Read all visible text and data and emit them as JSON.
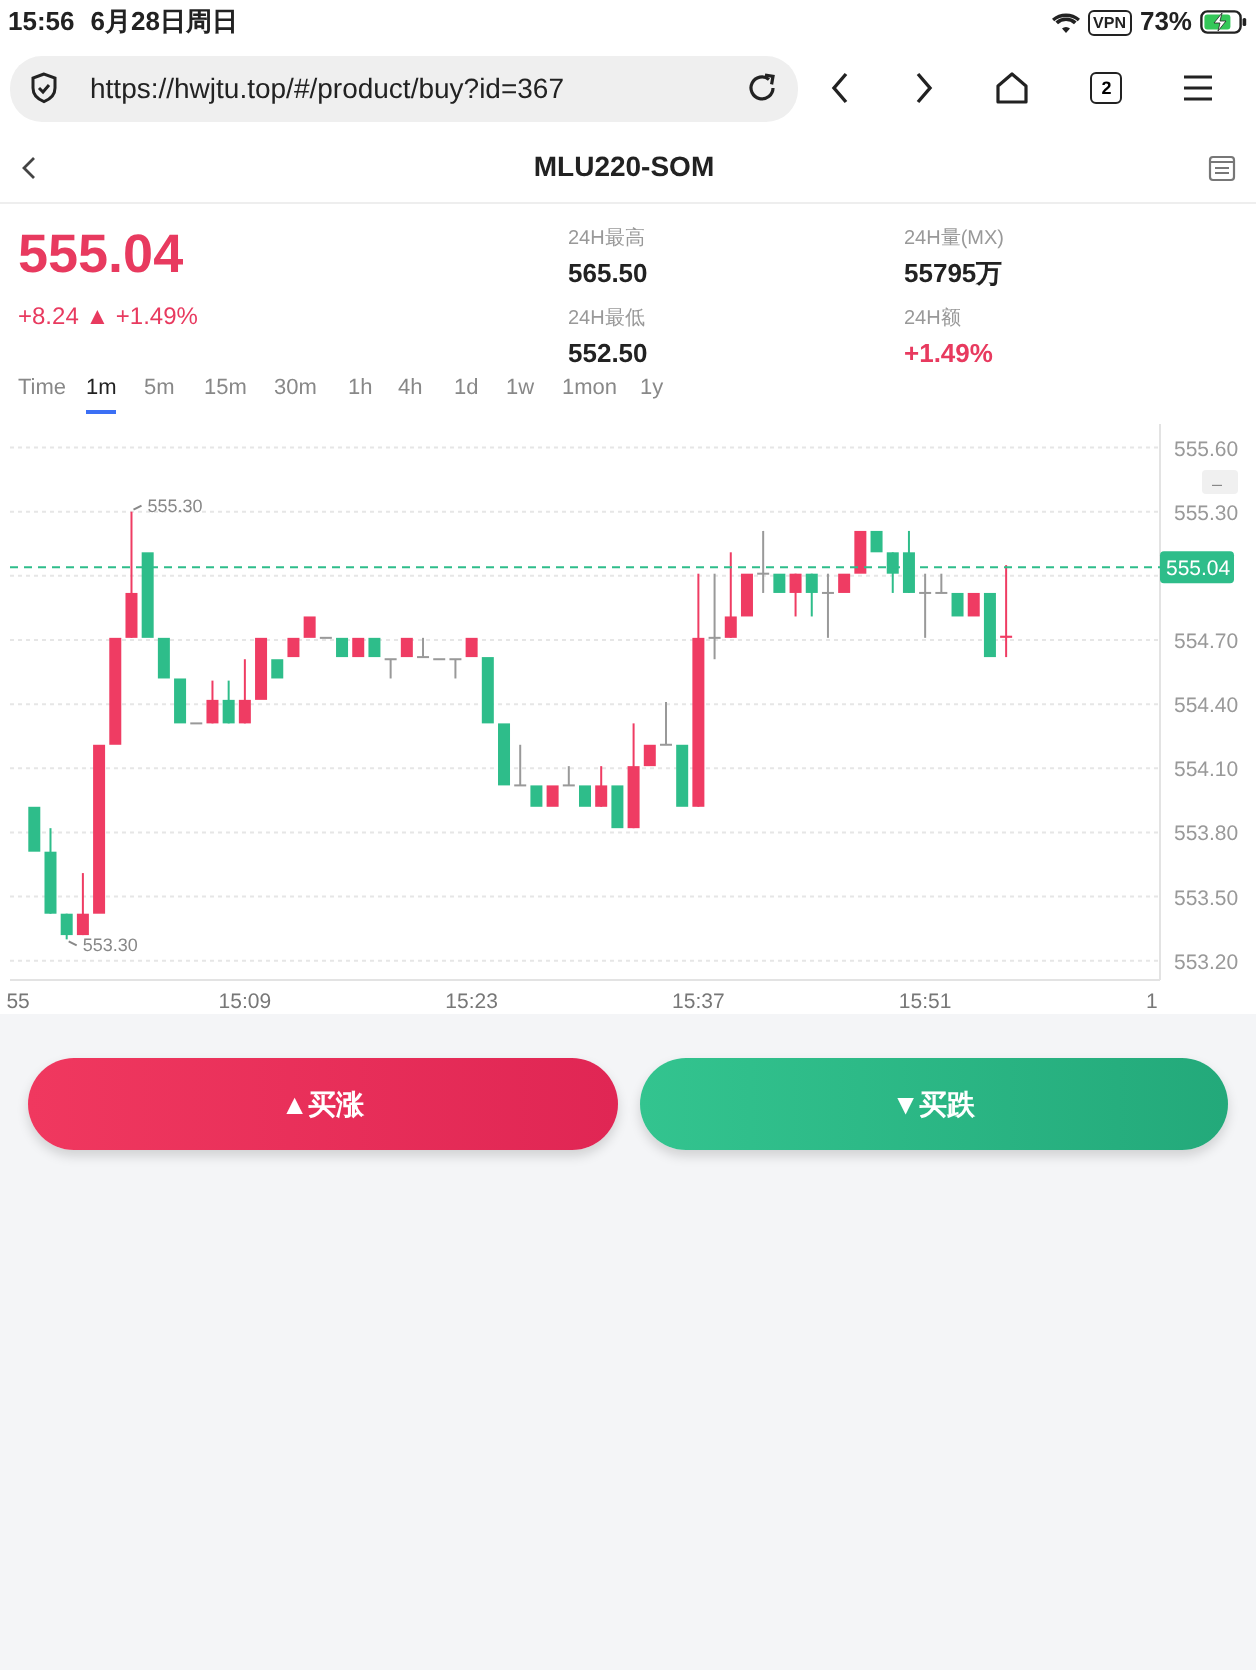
{
  "status_bar": {
    "time": "15:56",
    "date": "6月28日周日",
    "vpn": "VPN",
    "battery": "73%"
  },
  "browser": {
    "url": "https://hwjtu.top/#/product/buy?id=367",
    "tab_count": "2"
  },
  "header": {
    "title": "MLU220-SOM"
  },
  "quote": {
    "price": "555.04",
    "change": "+8.24 ▲ +1.49%"
  },
  "stats": [
    {
      "label": "24H最高",
      "value": "565.50",
      "kind": "plain"
    },
    {
      "label": "24H量(MX)",
      "value": "55795万",
      "kind": "plain"
    },
    {
      "label": "24H最低",
      "value": "552.50",
      "kind": "plain"
    },
    {
      "label": "24H额",
      "value": "+1.49%",
      "kind": "up"
    }
  ],
  "intervals": [
    {
      "label": "Time",
      "selected": false
    },
    {
      "label": "1m",
      "selected": true
    },
    {
      "label": "5m",
      "selected": false
    },
    {
      "label": "15m",
      "selected": false
    },
    {
      "label": "30m",
      "selected": false
    },
    {
      "label": "1h",
      "selected": false
    },
    {
      "label": "4h",
      "selected": false
    },
    {
      "label": "1d",
      "selected": false
    },
    {
      "label": "1w",
      "selected": false
    },
    {
      "label": "1mon",
      "selected": false
    },
    {
      "label": "1y",
      "selected": false
    }
  ],
  "chart": {
    "zoom_button": "–",
    "chart_data": {
      "type": "candlestick",
      "categories": [
        "55",
        null,
        null,
        null,
        null,
        null,
        null,
        null,
        null,
        null,
        null,
        null,
        null,
        null,
        "15:09",
        null,
        null,
        null,
        null,
        null,
        null,
        null,
        null,
        null,
        null,
        null,
        null,
        null,
        "15:23",
        null,
        null,
        null,
        null,
        null,
        null,
        null,
        null,
        null,
        null,
        null,
        null,
        null,
        "15:37",
        null,
        null,
        null,
        null,
        null,
        null,
        null,
        null,
        null,
        null,
        null,
        null,
        null,
        "15:51",
        null,
        null,
        null,
        null,
        null,
        null,
        null,
        null,
        null,
        null,
        null,
        null,
        null,
        "1"
      ],
      "ohlc": [
        null,
        [
          553.92,
          553.92,
          553.71,
          553.71
        ],
        [
          553.71,
          553.82,
          553.42,
          553.42
        ],
        [
          553.42,
          553.42,
          553.3,
          553.32
        ],
        [
          553.32,
          553.61,
          553.32,
          553.42
        ],
        [
          553.42,
          554.21,
          553.42,
          554.21
        ],
        [
          554.21,
          554.71,
          554.21,
          554.71
        ],
        [
          554.71,
          555.3,
          554.71,
          554.92
        ],
        [
          555.11,
          555.11,
          554.71,
          554.71
        ],
        [
          554.71,
          554.71,
          554.52,
          554.52
        ],
        [
          554.52,
          554.52,
          554.31,
          554.31
        ],
        [
          554.31,
          554.31,
          554.31,
          554.31
        ],
        [
          554.31,
          554.51,
          554.31,
          554.42
        ],
        [
          554.42,
          554.51,
          554.31,
          554.31
        ],
        [
          554.31,
          554.61,
          554.31,
          554.42
        ],
        [
          554.42,
          554.71,
          554.42,
          554.71
        ],
        [
          554.61,
          554.61,
          554.52,
          554.52
        ],
        [
          554.62,
          554.71,
          554.62,
          554.71
        ],
        [
          554.71,
          554.81,
          554.71,
          554.81
        ],
        [
          554.71,
          554.71,
          554.71,
          554.71
        ],
        [
          554.71,
          554.71,
          554.62,
          554.62
        ],
        [
          554.62,
          554.71,
          554.62,
          554.71
        ],
        [
          554.71,
          554.71,
          554.62,
          554.62
        ],
        [
          554.61,
          554.61,
          554.52,
          554.61
        ],
        [
          554.62,
          554.71,
          554.62,
          554.71
        ],
        [
          554.62,
          554.71,
          554.62,
          554.62
        ],
        [
          554.61,
          554.61,
          554.61,
          554.61
        ],
        [
          554.61,
          554.61,
          554.52,
          554.61
        ],
        [
          554.62,
          554.71,
          554.62,
          554.71
        ],
        [
          554.62,
          554.62,
          554.31,
          554.31
        ],
        [
          554.31,
          554.31,
          554.02,
          554.02
        ],
        [
          554.02,
          554.21,
          554.02,
          554.02
        ],
        [
          554.02,
          554.02,
          553.92,
          553.92
        ],
        [
          553.92,
          554.02,
          553.92,
          554.02
        ],
        [
          554.02,
          554.11,
          554.02,
          554.02
        ],
        [
          554.02,
          554.02,
          553.92,
          553.92
        ],
        [
          553.92,
          554.11,
          553.92,
          554.02
        ],
        [
          554.02,
          554.02,
          553.82,
          553.82
        ],
        [
          553.82,
          554.31,
          553.82,
          554.11
        ],
        [
          554.11,
          554.21,
          554.11,
          554.21
        ],
        [
          554.21,
          554.41,
          554.21,
          554.21
        ],
        [
          554.21,
          554.21,
          553.92,
          553.92
        ],
        [
          553.92,
          555.01,
          553.92,
          554.71
        ],
        [
          554.71,
          555.01,
          554.61,
          554.71
        ],
        [
          554.71,
          555.11,
          554.71,
          554.81
        ],
        [
          554.81,
          555.01,
          554.81,
          555.01
        ],
        [
          555.01,
          555.21,
          554.92,
          555.01
        ],
        [
          555.01,
          555.01,
          554.92,
          554.92
        ],
        [
          554.92,
          555.01,
          554.81,
          555.01
        ],
        [
          555.01,
          555.01,
          554.81,
          554.92
        ],
        [
          554.92,
          555.01,
          554.71,
          554.92
        ],
        [
          554.92,
          555.01,
          554.92,
          555.01
        ],
        [
          555.01,
          555.21,
          555.01,
          555.21
        ],
        [
          555.21,
          555.21,
          555.11,
          555.11
        ],
        [
          555.11,
          555.11,
          554.92,
          555.01
        ],
        [
          555.11,
          555.21,
          554.92,
          554.92
        ],
        [
          554.92,
          555.01,
          554.71,
          554.92
        ],
        [
          554.92,
          555.01,
          554.92,
          554.92
        ],
        [
          554.92,
          554.92,
          554.81,
          554.81
        ],
        [
          554.81,
          554.92,
          554.81,
          554.92
        ],
        [
          554.92,
          554.92,
          554.62,
          554.62
        ],
        [
          554.71,
          555.05,
          554.62,
          554.72
        ],
        null,
        null,
        null,
        null,
        null,
        null,
        null,
        null,
        null
      ],
      "ylim": [
        553.11,
        555.71
      ],
      "yticks": [
        {
          "value": 555.6,
          "label": "555.60"
        },
        {
          "value": 555.3,
          "label": "555.30"
        },
        {
          "value": 554.7,
          "label": "554.70"
        },
        {
          "value": 554.4,
          "label": "554.40"
        },
        {
          "value": 554.1,
          "label": "554.10"
        },
        {
          "value": 553.8,
          "label": "553.80"
        },
        {
          "value": 553.5,
          "label": "553.50"
        },
        {
          "value": 553.2,
          "label": "553.20"
        }
      ],
      "grid": true,
      "annotations": [
        "555.30",
        "553.30"
      ],
      "ref_lines": [
        {
          "axis": "y",
          "value": 555.04,
          "label": "555.04"
        }
      ]
    }
  },
  "buttons": [
    {
      "label": "▲买涨",
      "kind": "buy"
    },
    {
      "label": "▼买跌",
      "kind": "sell"
    }
  ]
}
